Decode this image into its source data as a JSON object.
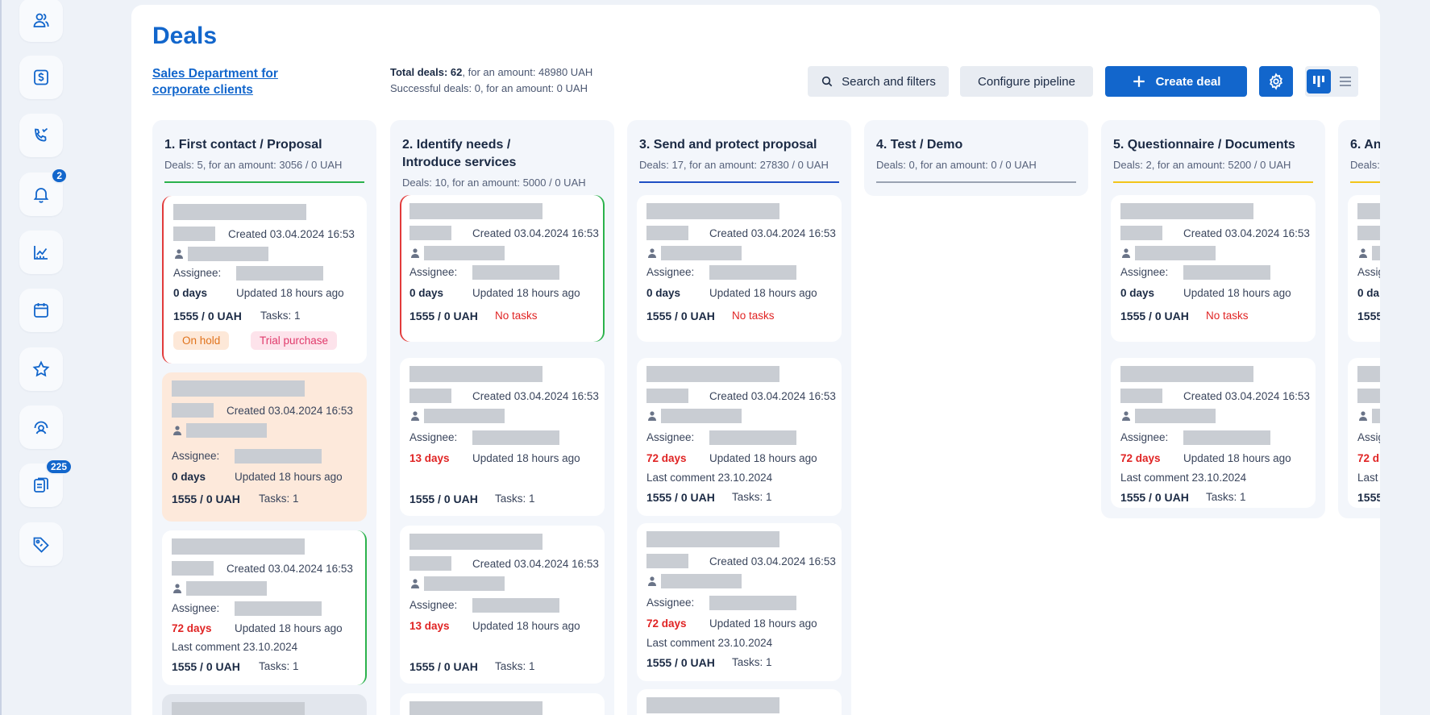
{
  "sidebar": {
    "items": [
      {
        "icon": "users-icon",
        "badge": ""
      },
      {
        "icon": "dollar-icon",
        "badge": ""
      },
      {
        "icon": "phone-call-icon",
        "badge": ""
      },
      {
        "icon": "bell-icon",
        "badge": "2"
      },
      {
        "icon": "chart-icon",
        "badge": ""
      },
      {
        "icon": "calendar-icon",
        "badge": ""
      },
      {
        "icon": "star-icon",
        "badge": ""
      },
      {
        "icon": "support-icon",
        "badge": ""
      },
      {
        "icon": "tasks-icon",
        "badge": "225"
      },
      {
        "icon": "tag-icon",
        "badge": ""
      }
    ]
  },
  "header": {
    "title": "Deals",
    "department": "Sales Department for corporate clients",
    "total_label": "Total deals:",
    "total_value": "62",
    "total_amount": ", for an amount: 48980 UAH",
    "success_text": "Successful deals: 0, for an amount: 0 UAH",
    "search_label": "Search and filters",
    "config_label": "Configure pipeline",
    "create_label": "Create deal"
  },
  "colors": {
    "accent": "#1266cc",
    "danger": "#e02424",
    "success": "#2bb24c"
  },
  "columns": [
    {
      "title": "1. First contact / Proposal",
      "sub": "Deals: 5, for an amount: 3056 / 0 UAH",
      "line_color": "#2bb24c",
      "cards": [
        {
          "created": "Created 03.04.2024 16:53",
          "assignee": "Assignee:",
          "days": "0 days",
          "updated": "Updated 18 hours ago",
          "amount": "1555 / 0 UAH",
          "tasks": "Tasks: 1",
          "tag1": "On hold",
          "tag2": "Trial purchase"
        },
        {
          "created": "Created 03.04.2024 16:53",
          "assignee": "Assignee:",
          "days": "0 days",
          "updated": "Updated 18 hours ago",
          "amount": "1555 / 0 UAH",
          "tasks": "Tasks: 1"
        },
        {
          "created": "Created 03.04.2024 16:53",
          "assignee": "Assignee:",
          "days": "72 days",
          "updated": "Updated 18 hours ago",
          "comment": "Last comment 23.10.2024",
          "amount": "1555 / 0 UAH",
          "tasks": "Tasks: 1"
        }
      ]
    },
    {
      "title": "2. Identify needs / Introduce services",
      "sub": "Deals: 10, for an amount: 5000 / 0 UAH",
      "line_color": "#2bb24c",
      "cards": [
        {
          "created": "Created 03.04.2024 16:53",
          "assignee": "Assignee:",
          "days": "0 days",
          "updated": "Updated 18 hours ago",
          "amount": "1555 / 0 UAH",
          "tasks": "No tasks"
        },
        {
          "created": "Created 03.04.2024 16:53",
          "assignee": "Assignee:",
          "days": "13 days",
          "updated": "Updated 18 hours ago",
          "amount": "1555 / 0 UAH",
          "tasks": "Tasks: 1"
        },
        {
          "created": "Created 03.04.2024 16:53",
          "assignee": "Assignee:",
          "days": "13 days",
          "updated": "Updated 18 hours ago",
          "amount": "1555 / 0 UAH",
          "tasks": "Tasks: 1"
        }
      ]
    },
    {
      "title": "3. Send and protect proposal",
      "sub": "Deals: 17, for an amount: 27830 / 0 UAH",
      "line_color": "#1f4fc4",
      "cards": [
        {
          "created": "Created 03.04.2024 16:53",
          "assignee": "Assignee:",
          "days": "0 days",
          "updated": "Updated 18 hours ago",
          "amount": "1555 / 0 UAH",
          "tasks": "No tasks"
        },
        {
          "created": "Created 03.04.2024 16:53",
          "assignee": "Assignee:",
          "days": "72 days",
          "updated": "Updated 18 hours ago",
          "comment": "Last comment 23.10.2024",
          "amount": "1555 / 0 UAH",
          "tasks": "Tasks: 1"
        },
        {
          "created": "Created 03.04.2024 16:53",
          "assignee": "Assignee:",
          "days": "72 days",
          "updated": "Updated 18 hours ago",
          "comment": "Last comment 23.10.2024",
          "amount": "1555 / 0 UAH",
          "tasks": "Tasks: 1"
        }
      ]
    },
    {
      "title": "4. Test / Demo",
      "sub": "Deals: 0, for an amount: 0 / 0 UAH",
      "line_color": "#9aa3b2",
      "cards": []
    },
    {
      "title": "5. Questionnaire / Documents",
      "sub": "Deals: 2, for an amount: 5200 / 0 UAH",
      "line_color": "#f2c41a",
      "cards": [
        {
          "created": "Created 03.04.2024 16:53",
          "assignee": "Assignee:",
          "days": "0 days",
          "updated": "Updated 18 hours ago",
          "amount": "1555 / 0 UAH",
          "tasks": "No tasks"
        },
        {
          "created": "Created 03.04.2024 16:53",
          "assignee": "Assignee:",
          "days": "72 days",
          "updated": "Updated 18 hours ago",
          "comment": "Last comment 23.10.2024",
          "amount": "1555 / 0 UAH",
          "tasks": "Tasks: 1"
        }
      ]
    },
    {
      "title": "6. An",
      "sub": "Deals:",
      "line_color": "#f2c41a",
      "cards": [
        {
          "assignee": "Assig",
          "days": "0 da",
          "amount": "1555"
        },
        {
          "assignee": "Assig",
          "days": "72 d",
          "comment": "Last",
          "amount": "1555"
        }
      ]
    }
  ]
}
